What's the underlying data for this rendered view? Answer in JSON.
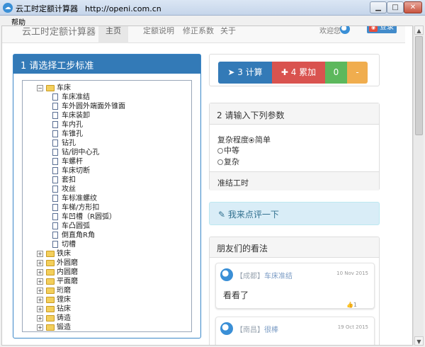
{
  "window": {
    "title": "云工时定额计算器",
    "url": "http://openi.com.cn",
    "menu_help": "帮助"
  },
  "navbar": {
    "brand": "云工时定额计算器",
    "items": [
      "主页",
      "定额说明",
      "修正系数",
      "关于"
    ],
    "welcome": "欢迎您",
    "login": "登录"
  },
  "step1": {
    "title": "1 请选择工步标准",
    "tree": {
      "expanded": {
        "label": "车床",
        "children": [
          "车床准结",
          "车外圆外端面外锥面",
          "车床装卸",
          "车内孔",
          "车锥孔",
          "钻孔",
          "钻/钥中心孔",
          "车螺杆",
          "车床切断",
          "套扣",
          "攻丝",
          "车标准螺纹",
          "车梯/方形扣",
          "车凹槽（R圆弧）",
          "车凸圆弧",
          "倒直角R角",
          "切槽"
        ]
      },
      "collapsed": [
        "铁床",
        "外圆磨",
        "内圆磨",
        "平面磨",
        "珩磨",
        "镗床",
        "钻床",
        "铸造",
        "锻造"
      ]
    }
  },
  "actions": {
    "calc": "3 计算",
    "accum": "4 累加",
    "zero": "0",
    "minus": "-"
  },
  "step2": {
    "title": "2 请输入下列参数",
    "param_label": "复杂程度",
    "options": [
      "简单",
      "中等",
      "复杂"
    ],
    "selected": "简单",
    "footer": "准结工时"
  },
  "comment": {
    "label": "我来点评一下"
  },
  "friends": {
    "title": "朋友们的看法",
    "comments": [
      {
        "location": "【成都】",
        "topic": "车床准结",
        "date": "10 Nov 2015",
        "text": "看看了",
        "likes": "1"
      },
      {
        "location": "【南昌】",
        "topic": "很棒",
        "date": "19 Oct 2015",
        "text": "",
        "likes": ""
      }
    ]
  },
  "colors": {
    "primary": "#337ab7",
    "danger": "#d9534f",
    "success": "#5cb85c",
    "warning": "#f0ad4e",
    "info_bg": "#d9edf7"
  }
}
